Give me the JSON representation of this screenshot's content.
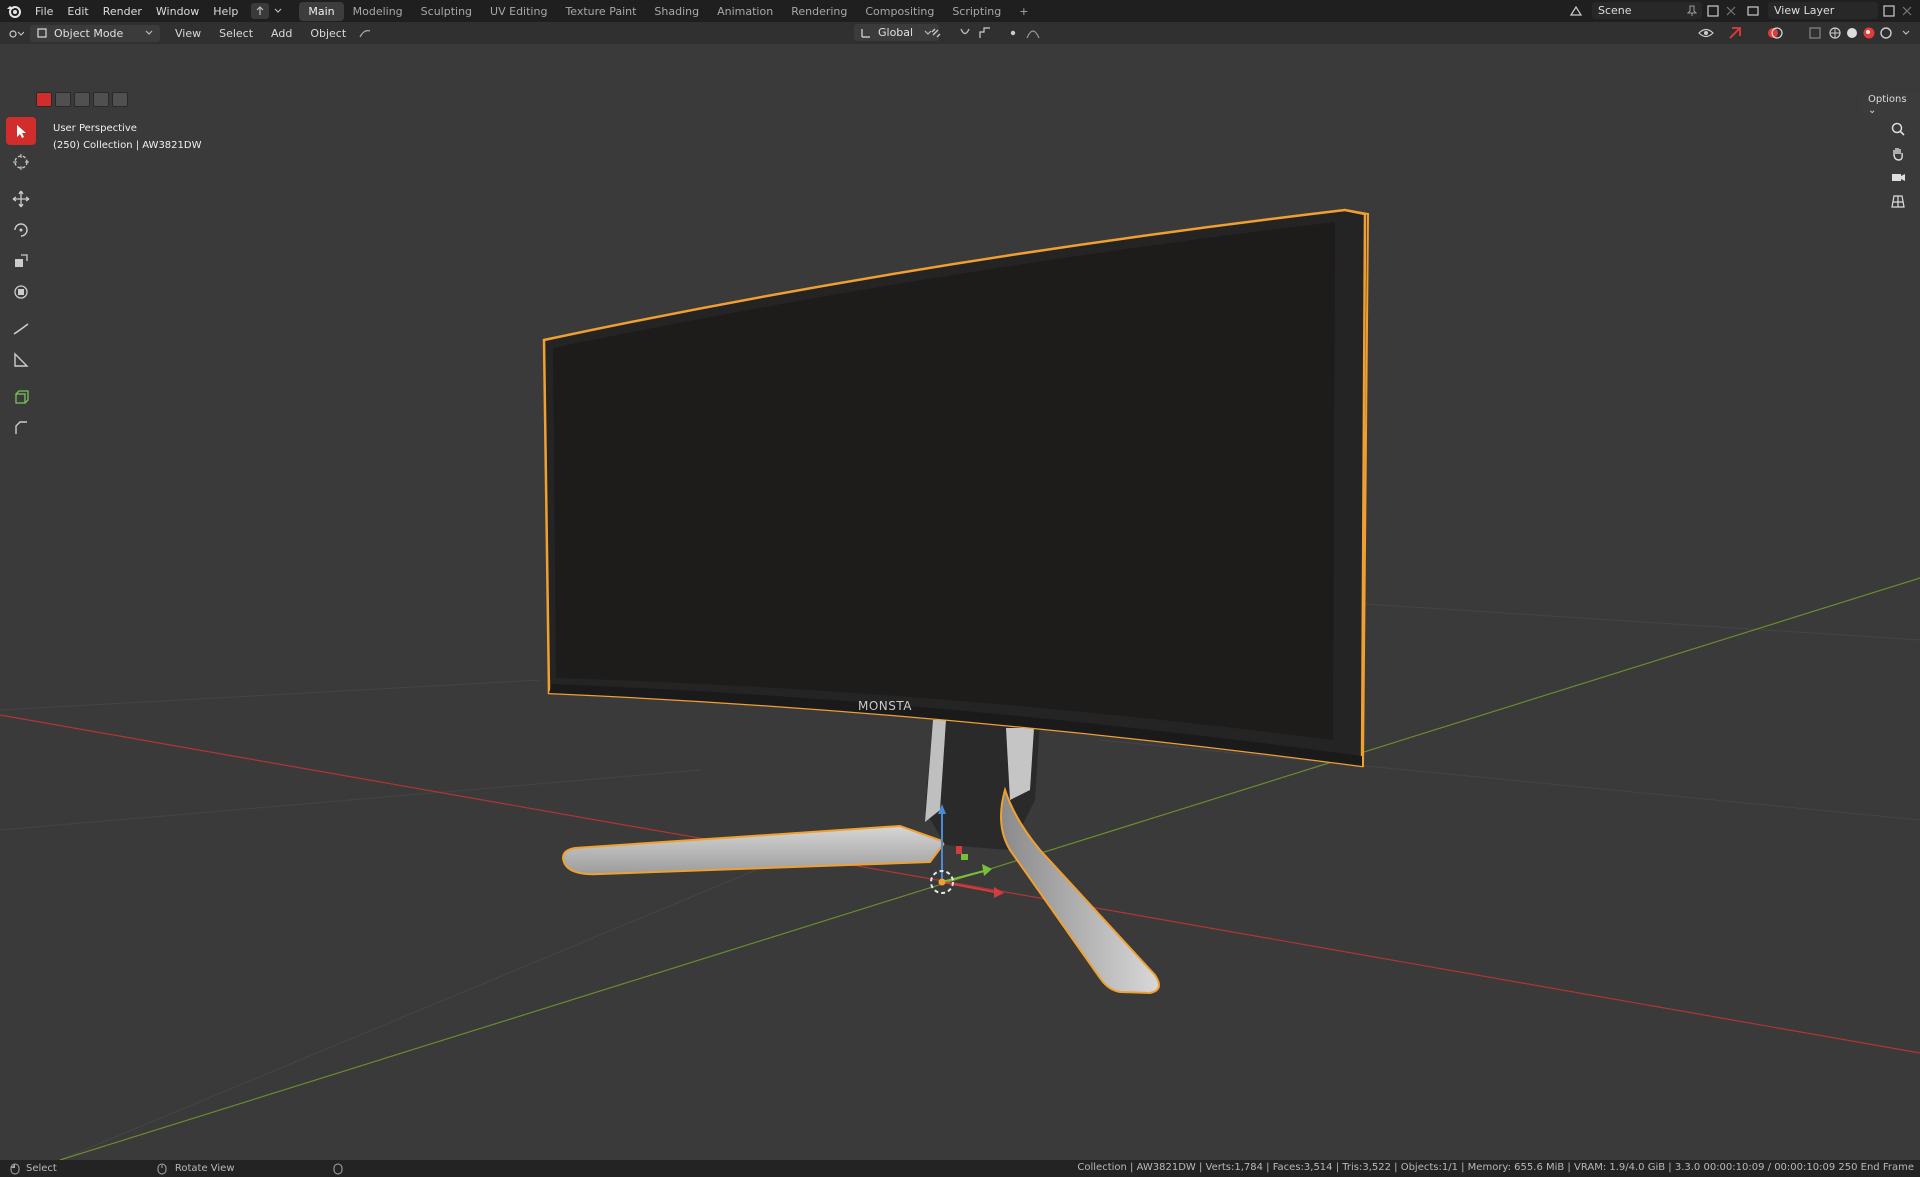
{
  "menu": {
    "items": [
      "File",
      "Edit",
      "Render",
      "Window",
      "Help"
    ]
  },
  "workspaces": {
    "tabs": [
      "Main",
      "Modeling",
      "Sculpting",
      "UV Editing",
      "Texture Paint",
      "Shading",
      "Animation",
      "Rendering",
      "Compositing",
      "Scripting"
    ],
    "active": "Main",
    "add_label": "+"
  },
  "scene": {
    "name": "Scene"
  },
  "view_layer": {
    "name": "View Layer"
  },
  "header": {
    "mode": "Object Mode",
    "menus": [
      "View",
      "Select",
      "Add",
      "Object"
    ],
    "transform_orientation": "Global",
    "options_label": "Options"
  },
  "viewport": {
    "perspective_label": "User Perspective",
    "collection_label": "(250) Collection | AW3821DW",
    "brand_text": "MONSTA"
  },
  "statusbar": {
    "select_label": "Select",
    "rotate_label": "Rotate View",
    "stats": "Collection | AW3821DW | Verts:1,784 | Faces:3,514 | Tris:3,522 | Objects:1/1 | Memory: 655.6 MiB | VRAM: 1.9/4.0 GiB | 3.3.0   00:00:10:09 / 00:00:10:09   250 End Frame"
  },
  "colors": {
    "accent_red": "#d22d2d",
    "selection_orange": "#f0a030",
    "axis_x": "#c83838",
    "axis_y": "#7aa032",
    "viewport_bg": "#3a3a3a"
  }
}
